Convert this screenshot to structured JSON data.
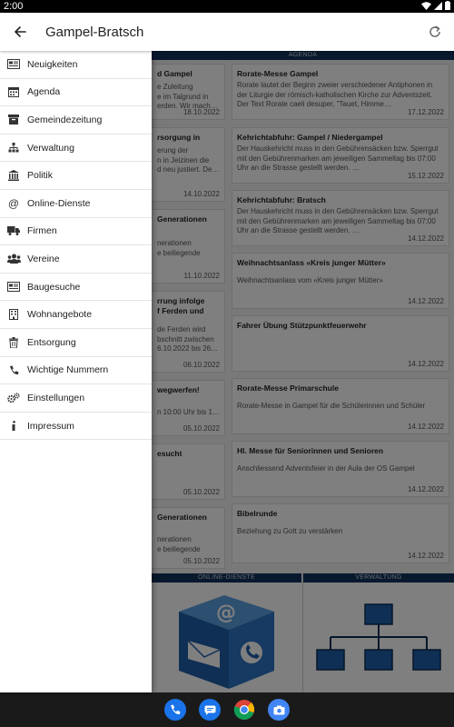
{
  "status_bar": {
    "time": "2:00"
  },
  "app_bar": {
    "title": "Gampel-Bratsch"
  },
  "sections": {
    "agenda": "AGENDA",
    "online_dienste": "ONLINE-DIENSTE",
    "verwaltung": "VERWALTUNG"
  },
  "left_cards": [
    {
      "title": "d Gampel",
      "text": "e Zuleitung\ne im Talgrund in\nerden. Wir mach…",
      "date": "18.10.2022"
    },
    {
      "title": "rsorgung in",
      "text": "erung der\nn in Jeizinen die\nd neu justiert. De…",
      "date": "14.10.2022"
    },
    {
      "title": "Generationen",
      "text": "nerationen\ne beiliegende",
      "date": "11.10.2022"
    },
    {
      "title": "rrung infolge\nf Ferden und",
      "text": "de Ferden wird\nbschnitt zwischen\n6.10.2022 bis 26…",
      "date": "06.10.2022"
    },
    {
      "title": "wegwerfen!",
      "text": "n 10:00 Uhr bis 1…",
      "date": "05.10.2022"
    },
    {
      "title": "esucht",
      "text": "",
      "date": "05.10.2022"
    },
    {
      "title": "Generationen",
      "text": "nerationen\ne beiliegende",
      "date": "05.10.2022"
    }
  ],
  "agenda": [
    {
      "title": "Rorate-Messe Gampel",
      "text": "Rorate lautet der Beginn zweier verschiedener Antiphonen in der Liturgie der römisch-katholischen Kirche zur Adventszeit. Der Text Rorate caeli desuper, \"Tauet, Himme…",
      "date": "17.12.2022"
    },
    {
      "title": "Kehrichtabfuhr: Gampel / Niedergampel",
      "text": "Der Hauskehricht muss in den Gebührensäcken bzw. Sperrgut mit den Gebührenmarken am jeweiligen Sammeltag bis 07:00 Uhr an die Strasse gestellt werden. …",
      "date": "15.12.2022"
    },
    {
      "title": "Kehrichtabfuhr: Bratsch",
      "text": "Der Hauskehricht muss in den Gebührensäcken bzw. Sperrgut mit den Gebührenmarken am jeweiligen Sammeltag bis 07:00 Uhr an die Strasse gestellt werden. …",
      "date": "14.12.2022"
    },
    {
      "title": "Weihnachtsanlass «Kreis junger Mütter»",
      "text": "Weihnachtsanlass vom «Kreis junger Mütter»",
      "date": "14.12.2022"
    },
    {
      "title": "Fahrer Übung Stützpunktfeuerwehr",
      "text": "",
      "date": "14.12.2022"
    },
    {
      "title": "Rorate-Messe Primarschule",
      "text": "Rorate-Messe in Gampel für die Schülerinnen und Schüler",
      "date": "14.12.2022"
    },
    {
      "title": "Hl. Messe für Seniorinnen und Senioren",
      "text": "Anschliessend Adventsfeier in der Aula der OS Gampel",
      "date": "14.12.2022"
    },
    {
      "title": "Bibelrunde",
      "text": "Beziehung zu Gott zu verstärken",
      "date": "14.12.2022"
    }
  ],
  "drawer": {
    "items": [
      {
        "label": "Neuigkeiten",
        "icon": "newspaper-icon"
      },
      {
        "label": "Agenda",
        "icon": "calendar-icon"
      },
      {
        "label": "Gemeindezeitung",
        "icon": "archive-icon"
      },
      {
        "label": "Verwaltung",
        "icon": "sitemap-icon"
      },
      {
        "label": "Politik",
        "icon": "institution-icon"
      },
      {
        "label": "Online-Dienste",
        "icon": "at-icon"
      },
      {
        "label": "Firmen",
        "icon": "truck-icon"
      },
      {
        "label": "Vereine",
        "icon": "users-icon"
      },
      {
        "label": "Baugesuche",
        "icon": "newspaper-icon"
      },
      {
        "label": "Wohnangebote",
        "icon": "building-icon"
      },
      {
        "label": "Entsorgung",
        "icon": "trash-icon"
      },
      {
        "label": "Wichtige Nummern",
        "icon": "phone-icon"
      },
      {
        "label": "Einstellungen",
        "icon": "gears-icon"
      },
      {
        "label": "Impressum",
        "icon": "info-icon"
      }
    ]
  },
  "dock": [
    "phone-app-icon",
    "messages-app-icon",
    "chrome-app-icon",
    "camera-app-icon"
  ]
}
